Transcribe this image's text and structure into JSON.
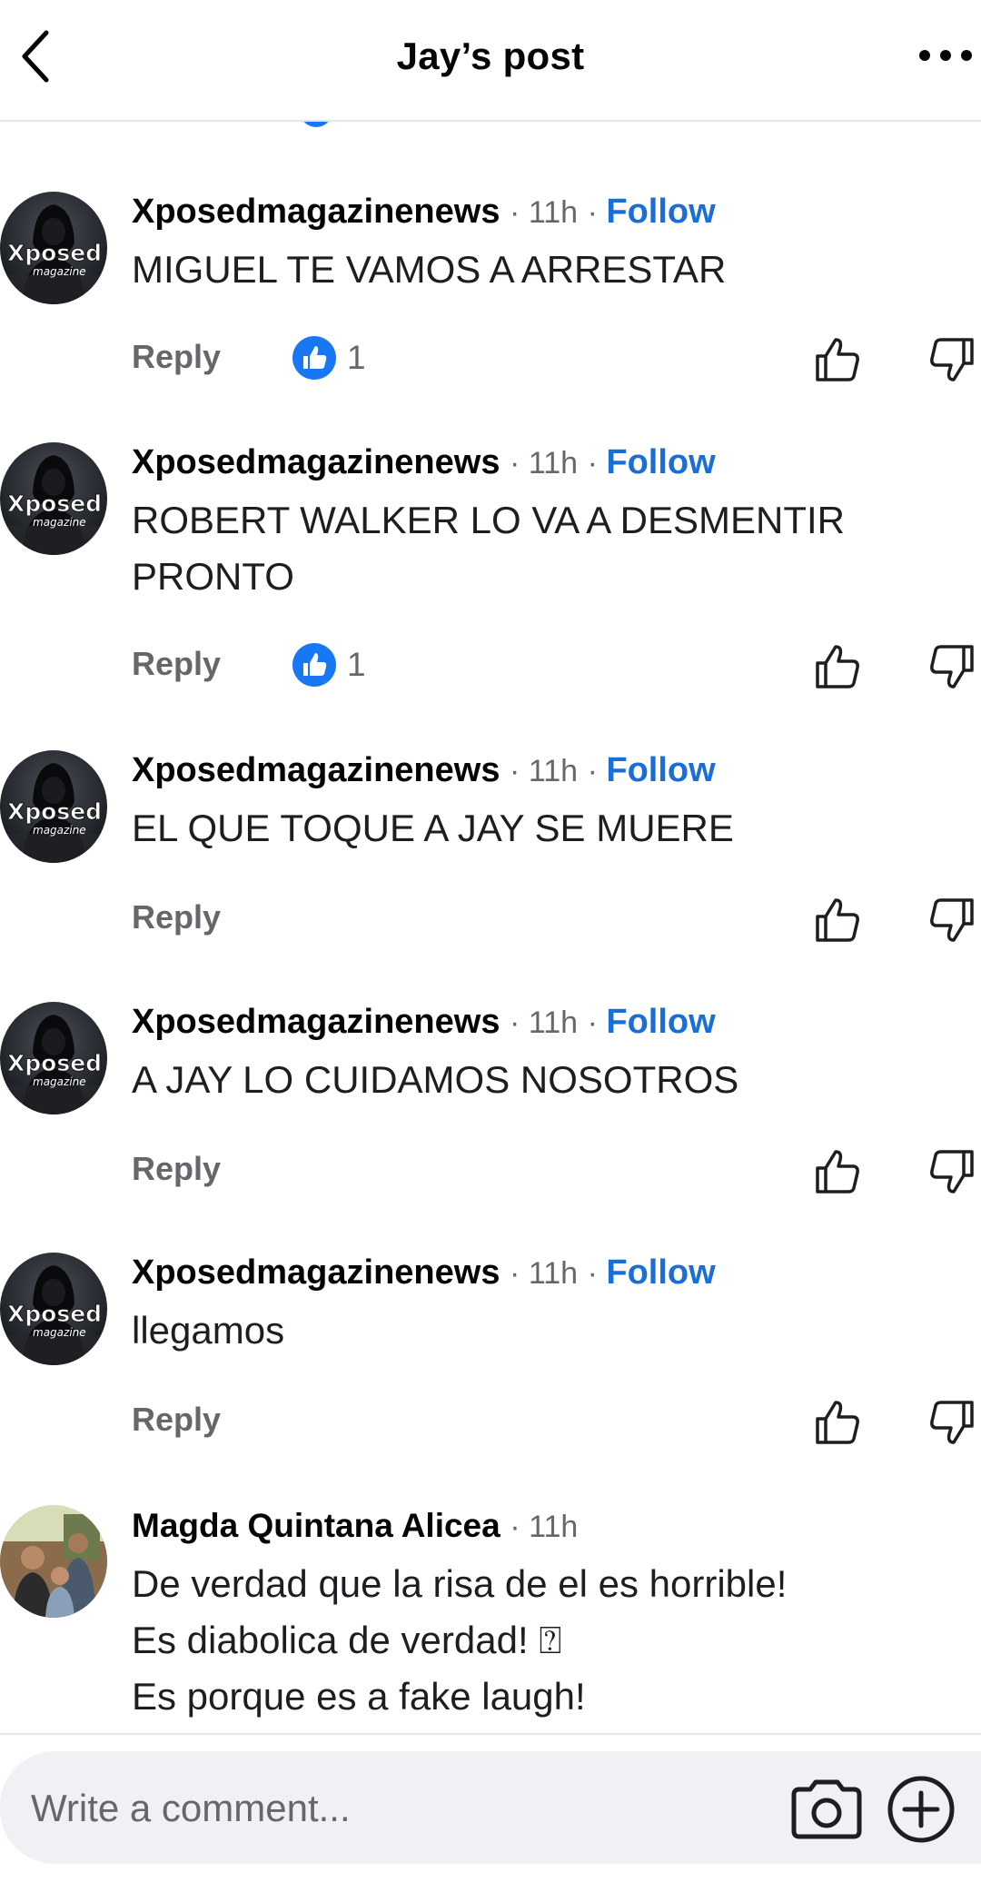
{
  "header": {
    "title": "Jay’s post"
  },
  "comments": [
    {
      "author": "Xposedmagazinenews",
      "time": "11h",
      "follow": "Follow",
      "text": [
        "MIGUEL TE VAMOS A ARRESTAR"
      ],
      "reply": "Reply",
      "reactions": "1"
    },
    {
      "author": "Xposedmagazinenews",
      "time": "11h",
      "follow": "Follow",
      "text": [
        "ROBERT WALKER LO VA A DESMENTIR",
        "PRONTO"
      ],
      "reply": "Reply",
      "reactions": "1"
    },
    {
      "author": "Xposedmagazinenews",
      "time": "11h",
      "follow": "Follow",
      "text": [
        "EL QUE TOQUE A JAY SE MUERE"
      ],
      "reply": "Reply"
    },
    {
      "author": "Xposedmagazinenews",
      "time": "11h",
      "follow": "Follow",
      "text": [
        "A JAY LO CUIDAMOS NOSOTROS"
      ],
      "reply": "Reply"
    },
    {
      "author": "Xposedmagazinenews",
      "time": "11h",
      "follow": "Follow",
      "text": [
        "llegamos"
      ],
      "reply": "Reply"
    },
    {
      "author": "Magda Quintana Alicea",
      "time": "11h",
      "text": [
        "De verdad que la risa de el es horrible!",
        "Es diabolica de verdad! ⍰",
        "Es porque es a fake laugh!"
      ]
    }
  ],
  "avatar_logo": {
    "line1": "Xposed",
    "line2": "magazine"
  },
  "composer": {
    "placeholder": "Write a comment..."
  },
  "icons": [
    "back-icon",
    "more-icon",
    "like-reaction-icon",
    "thumbs-up-icon",
    "thumbs-down-icon",
    "camera-icon",
    "plus-circle-icon"
  ],
  "colors": {
    "follow": "#1a6ed8",
    "like": "#1877f2",
    "meta": "#65676b"
  }
}
